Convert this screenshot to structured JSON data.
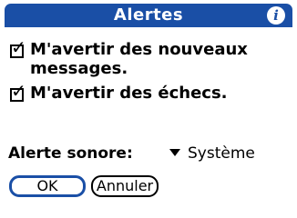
{
  "dialog": {
    "title": "Alertes",
    "info_icon": "info-icon",
    "accent_color": "#1a4fa6"
  },
  "options": [
    {
      "label_line1": "M'avertir des nouveaux",
      "label_line2": "messages.",
      "checked": true
    },
    {
      "label_line1": "M'avertir des échecs.",
      "checked": true
    }
  ],
  "sound": {
    "label": "Alerte sonore:",
    "selected": "Système"
  },
  "buttons": {
    "ok": "OK",
    "cancel": "Annuler"
  }
}
